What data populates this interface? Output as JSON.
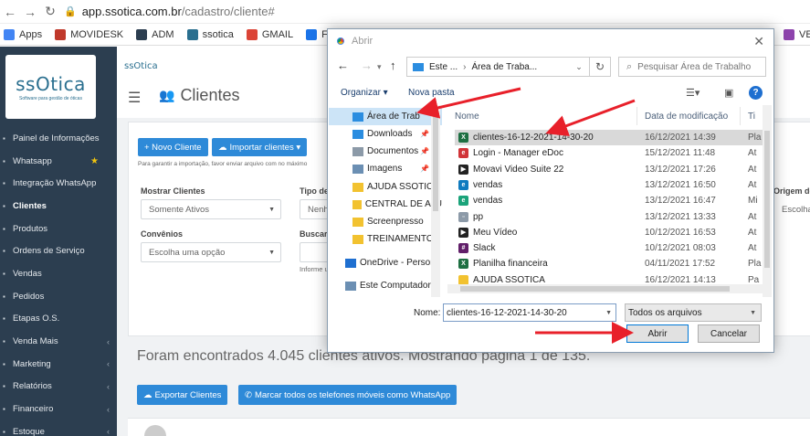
{
  "browser": {
    "url_domain": "app.ssotica.com.br",
    "url_path": "/cadastro/cliente#",
    "bookmarks": [
      {
        "label": "Apps",
        "color": "#4285f4"
      },
      {
        "label": "MOVIDESK",
        "color": "#c0392b"
      },
      {
        "label": "ADM",
        "color": "#2c3e50"
      },
      {
        "label": "ssotica",
        "color": "#2a6f8f"
      },
      {
        "label": "GMAIL",
        "color": "#db4437"
      },
      {
        "label": "Fazer lig",
        "color": "#1a73e8"
      },
      {
        "label": "VE",
        "color": "#8e44ad"
      }
    ]
  },
  "sidebar": {
    "logo_text": "ssOtica",
    "logo_tagline": "Software para gestão de óticas",
    "items": [
      {
        "label": "Painel de Informações",
        "caret": ""
      },
      {
        "label": "Whatsapp",
        "caret": ""
      },
      {
        "label": "Integração WhatsApp",
        "caret": ""
      },
      {
        "label": "Clientes",
        "caret": ""
      },
      {
        "label": "Produtos",
        "caret": ""
      },
      {
        "label": "Ordens de Serviço",
        "caret": ""
      },
      {
        "label": "Vendas",
        "caret": ""
      },
      {
        "label": "Pedidos",
        "caret": ""
      },
      {
        "label": "Etapas O.S.",
        "caret": ""
      },
      {
        "label": "Venda Mais",
        "caret": "‹"
      },
      {
        "label": "Marketing",
        "caret": "‹"
      },
      {
        "label": "Relatórios",
        "caret": "‹"
      },
      {
        "label": "Financeiro",
        "caret": "‹"
      },
      {
        "label": "Estoque",
        "caret": "‹"
      }
    ]
  },
  "page": {
    "mini_logo": "ssOtica",
    "title": "Clientes",
    "btn_new": "+ Novo Cliente",
    "btn_import": "Importar clientes ▾",
    "import_hint": "Para garantir a importação, favor enviar arquivo com no máximo",
    "show_label": "Mostrar Clientes",
    "show_value": "Somente Ativos",
    "type_label": "Tipo de",
    "type_value": "Nenh",
    "convenios_label": "Convênios",
    "convenios_placeholder": "Escolha uma opção",
    "search_label": "Buscar p",
    "search_hint": "Informe u",
    "origem_label": "Origem do",
    "origem_value": "Escolha",
    "found_text": "Foram encontrados 4.045 clientes ativos. Mostrando página 1 de 135.",
    "btn_export": "Exportar Clientes",
    "btn_whatsapp": "Marcar todos os telefones móveis como WhatsApp"
  },
  "dialog": {
    "title": "Abrir",
    "path_parts": [
      "Este ...",
      "Área de Traba..."
    ],
    "search_placeholder": "Pesquisar Área de Trabalho",
    "organize_label": "Organizar ▾",
    "new_folder_label": "Nova pasta",
    "nav_items": [
      {
        "label": "Área de Trab",
        "color": "#2b8de0",
        "pin": "",
        "selected": true
      },
      {
        "label": "Downloads",
        "color": "#2b8de0",
        "pin": "📌",
        "selected": false
      },
      {
        "label": "Documentos",
        "color": "#8c9aa8",
        "pin": "📌",
        "selected": false
      },
      {
        "label": "Imagens",
        "color": "#6b8fb3",
        "pin": "📌",
        "selected": false
      },
      {
        "label": "AJUDA SSOTICA",
        "color": "#f2c230",
        "pin": "",
        "selected": false
      },
      {
        "label": "CENTRAL DE AJU",
        "color": "#f2c230",
        "pin": "",
        "selected": false
      },
      {
        "label": "Screenpresso",
        "color": "#f2c230",
        "pin": "",
        "selected": false
      },
      {
        "label": "TREINAMENTO",
        "color": "#f2c230",
        "pin": "",
        "selected": false
      },
      {
        "label": "OneDrive - Person",
        "color": "#1e6fd0",
        "pin": "",
        "selected": false
      },
      {
        "label": "Este Computador",
        "color": "#6b8fb3",
        "pin": "",
        "selected": false
      }
    ],
    "columns": [
      "Nome",
      "Data de modificação",
      "Ti"
    ],
    "files": [
      {
        "name": "clientes-16-12-2021-14-30-20",
        "date": "16/12/2021 14:39",
        "type": "Pla",
        "icon": "X",
        "color": "#1d6f42",
        "selected": true
      },
      {
        "name": "Login - Manager eDoc",
        "date": "15/12/2021 11:48",
        "type": "At",
        "icon": "e",
        "color": "#d13438",
        "selected": false
      },
      {
        "name": "Movavi Video Suite 22",
        "date": "13/12/2021 17:26",
        "type": "At",
        "icon": "▶",
        "color": "#222222",
        "selected": false
      },
      {
        "name": "vendas",
        "date": "13/12/2021 16:50",
        "type": "At",
        "icon": "e",
        "color": "#0f7bbf",
        "selected": false
      },
      {
        "name": "vendas",
        "date": "13/12/2021 16:47",
        "type": "Mi",
        "icon": "e",
        "color": "#1aa37a",
        "selected": false
      },
      {
        "name": "pp",
        "date": "13/12/2021 13:33",
        "type": "At",
        "icon": "▫",
        "color": "#8c9aa8",
        "selected": false
      },
      {
        "name": "Meu Vídeo",
        "date": "10/12/2021 16:53",
        "type": "At",
        "icon": "▶",
        "color": "#222222",
        "selected": false
      },
      {
        "name": "Slack",
        "date": "10/12/2021 08:03",
        "type": "At",
        "icon": "#",
        "color": "#611f69",
        "selected": false
      },
      {
        "name": "Planilha financeira",
        "date": "04/11/2021 17:52",
        "type": "Pla",
        "icon": "X",
        "color": "#1d6f42",
        "selected": false
      },
      {
        "name": "AJUDA SSOTICA",
        "date": "16/12/2021 14:13",
        "type": "Pa",
        "icon": "",
        "color": "#f2c230",
        "selected": false
      }
    ],
    "name_label": "Nome:",
    "name_value": "clientes-16-12-2021-14-30-20",
    "type_filter": "Todos os arquivos",
    "open_button": "Abrir",
    "cancel_button": "Cancelar"
  },
  "colors": {
    "arrow": "#e8202a",
    "accent": "#2e8ad8",
    "sidebar": "#2c3e50"
  }
}
